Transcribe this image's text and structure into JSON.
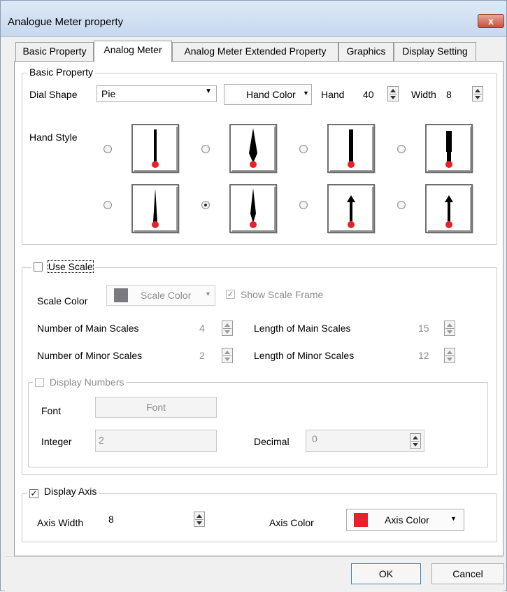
{
  "window": {
    "title": "Analogue Meter property",
    "close_glyph": "x"
  },
  "tabs": [
    {
      "label": "Basic Property"
    },
    {
      "label": "Analog Meter"
    },
    {
      "label": "Analog Meter Extended Property"
    },
    {
      "label": "Graphics"
    },
    {
      "label": "Display Setting"
    }
  ],
  "basic": {
    "group_label": "Basic Property",
    "dial_shape_label": "Dial Shape",
    "dial_shape_value": "Pie",
    "hand_color_label": "Hand Color",
    "hand_label": "Hand",
    "hand_value": "40",
    "width_label": "Width",
    "width_value": "8",
    "hand_style_label": "Hand Style",
    "selected_style": 5
  },
  "scale": {
    "use_scale_label": "Use Scale",
    "use_scale_checked": false,
    "scale_color_label": "Scale Color",
    "scale_color_button": "Scale Color",
    "show_frame_label": "Show Scale Frame",
    "show_frame_checked": true,
    "main_scales_label": "Number of Main Scales",
    "main_scales_value": "4",
    "minor_scales_label": "Number of Minor Scales",
    "minor_scales_value": "2",
    "len_main_label": "Length of Main Scales",
    "len_main_value": "15",
    "len_minor_label": "Length of Minor Scales",
    "len_minor_value": "12",
    "display_numbers_label": "Display Numbers",
    "font_label": "Font",
    "font_button": "Font",
    "integer_label": "Integer",
    "integer_value": "2",
    "decimal_label": "Decimal",
    "decimal_value": "0"
  },
  "axis": {
    "display_axis_label": "Display Axis",
    "display_axis_checked": true,
    "axis_width_label": "Axis Width",
    "axis_width_value": "8",
    "axis_color_label": "Axis Color",
    "axis_color_button": "Axis Color"
  },
  "footer": {
    "ok": "OK",
    "cancel": "Cancel"
  },
  "colors": {
    "hand_red": "#e8202a",
    "axis_color": "#e8202a",
    "scale_color": "#7a7a80",
    "selection": "#3c7fb1"
  }
}
